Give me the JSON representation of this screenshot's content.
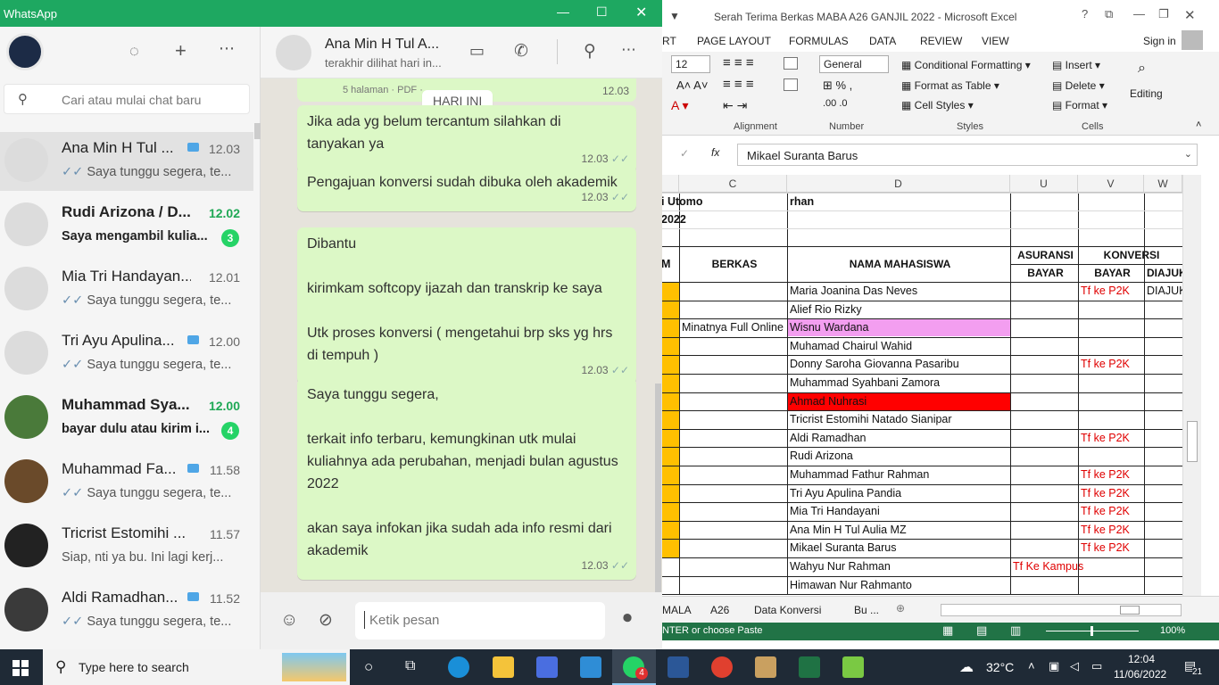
{
  "excel": {
    "title": "Serah Terima Berkas MABA A26 GANJIL 2022 - Microsoft Excel",
    "sign_in": "Sign in",
    "tabs": [
      "RT",
      "PAGE LAYOUT",
      "FORMULAS",
      "DATA",
      "REVIEW",
      "VIEW"
    ],
    "ribbon": {
      "font_size": "12",
      "number_format": "General",
      "alignment_label": "Alignment",
      "number_label": "Number",
      "styles_label": "Styles",
      "cells_label": "Cells",
      "conditional_formatting": "Conditional Formatting",
      "format_as_table": "Format as Table",
      "cell_styles": "Cell Styles",
      "insert": "Insert",
      "delete": "Delete",
      "format": "Format",
      "editing": "Editing"
    },
    "formula_bar": {
      "fx": "fx",
      "value": "Mikael Suranta Barus"
    },
    "columns": [
      "C",
      "D",
      "U",
      "V",
      "W"
    ],
    "top_rows": {
      "b1": "i Utomo",
      "d1": "rhan",
      "b2": "2022"
    },
    "headers": {
      "m": "M",
      "berkas": "BERKAS",
      "nama": "NAMA MAHASISWA",
      "asuransi": "ASURANSI",
      "konversi": "KONVERSI",
      "bayar1": "BAYAR",
      "bayar2": "BAYAR",
      "diajuk": "DIAJUK"
    },
    "rows": [
      {
        "c": "",
        "d": "Maria Joanina Das Neves",
        "u": "",
        "v": "Tf ke P2K",
        "w": "DIAJUK",
        "yellow": true,
        "fill": ""
      },
      {
        "c": "",
        "d": "Alief Rio Rizky",
        "u": "",
        "v": "",
        "w": "",
        "yellow": true,
        "fill": ""
      },
      {
        "c": "Minatnya Full Online",
        "d": "Wisnu Wardana",
        "u": "",
        "v": "",
        "w": "",
        "yellow": true,
        "fill": "#f39ef0"
      },
      {
        "c": "",
        "d": "Muhamad Chairul Wahid",
        "u": "",
        "v": "",
        "w": "",
        "yellow": true,
        "fill": ""
      },
      {
        "c": "",
        "d": "Donny Saroha Giovanna Pasaribu",
        "u": "",
        "v": "Tf ke P2K",
        "w": "",
        "yellow": true,
        "fill": ""
      },
      {
        "c": "",
        "d": "Muhammad Syahbani Zamora",
        "u": "",
        "v": "",
        "w": "",
        "yellow": true,
        "fill": ""
      },
      {
        "c": "",
        "d": "Ahmad Nuhrasi",
        "u": "",
        "v": "",
        "w": "",
        "yellow": true,
        "fill": "#ff0000"
      },
      {
        "c": "",
        "d": "Tricrist Estomihi Natado Sianipar",
        "u": "",
        "v": "",
        "w": "",
        "yellow": true,
        "fill": ""
      },
      {
        "c": "",
        "d": "Aldi Ramadhan",
        "u": "",
        "v": "Tf ke P2K",
        "w": "",
        "yellow": true,
        "fill": ""
      },
      {
        "c": "",
        "d": "Rudi Arizona",
        "u": "",
        "v": "",
        "w": "",
        "yellow": true,
        "fill": ""
      },
      {
        "c": "",
        "d": "Muhammad Fathur Rahman",
        "u": "",
        "v": "Tf ke P2K",
        "w": "",
        "yellow": true,
        "fill": ""
      },
      {
        "c": "",
        "d": "Tri Ayu Apulina Pandia",
        "u": "",
        "v": "Tf ke P2K",
        "w": "",
        "yellow": true,
        "fill": ""
      },
      {
        "c": "",
        "d": "Mia Tri Handayani",
        "u": "",
        "v": "Tf ke P2K",
        "w": "",
        "yellow": true,
        "fill": ""
      },
      {
        "c": "",
        "d": "Ana Min H Tul Aulia MZ",
        "u": "",
        "v": "Tf ke P2K",
        "w": "",
        "yellow": true,
        "fill": ""
      },
      {
        "c": "",
        "d": "Mikael Suranta Barus",
        "u": "",
        "v": "Tf ke P2K",
        "w": "",
        "yellow": true,
        "fill": ""
      },
      {
        "c": "",
        "d": "Wahyu Nur Rahman",
        "u": "Tf Ke Kampus",
        "v": "",
        "w": "",
        "yellow": false,
        "fill": ""
      },
      {
        "c": "",
        "d": "Himawan Nur Rahmanto",
        "u": "",
        "v": "",
        "w": "",
        "yellow": false,
        "fill": ""
      }
    ],
    "sheets": [
      "MALA",
      "A26",
      "Data Konversi",
      "Bu ..."
    ],
    "status": "NTER or choose Paste",
    "zoom": "100%"
  },
  "whatsapp": {
    "app_title": "WhatsApp",
    "search_placeholder": "Cari atau mulai chat baru",
    "chats": [
      {
        "name": "Ana Min H Tul ...",
        "time": "12.03",
        "preview": "Saya tunggu segera,   te...",
        "badge": "",
        "ticks": true,
        "pin": true,
        "bold": false,
        "selected": true
      },
      {
        "name": "Rudi Arizona / D...",
        "time": "12.02",
        "preview": "Saya mengambil kulia...",
        "badge": "3",
        "ticks": false,
        "pin": false,
        "bold": true,
        "selected": false
      },
      {
        "name": "Mia Tri Handayan...",
        "time": "12.01",
        "preview": "Saya tunggu segera,   te...",
        "badge": "",
        "ticks": true,
        "pin": false,
        "bold": false,
        "selected": false
      },
      {
        "name": "Tri Ayu Apulina...",
        "time": "12.00",
        "preview": "Saya tunggu segera,   te...",
        "badge": "",
        "ticks": true,
        "pin": true,
        "bold": false,
        "selected": false
      },
      {
        "name": "Muhammad Sya...",
        "time": "12.00",
        "preview": "bayar dulu atau kirim i...",
        "badge": "4",
        "ticks": false,
        "pin": false,
        "bold": true,
        "selected": false
      },
      {
        "name": "Muhammad Fa...",
        "time": "11.58",
        "preview": "Saya tunggu segera,   te...",
        "badge": "",
        "ticks": true,
        "pin": true,
        "bold": false,
        "selected": false
      },
      {
        "name": "Tricrist Estomihi ...",
        "time": "11.57",
        "preview": "Siap, nti ya bu. Ini lagi kerj...",
        "badge": "",
        "ticks": false,
        "pin": false,
        "bold": false,
        "selected": false
      },
      {
        "name": "Aldi Ramadhan...",
        "time": "11.52",
        "preview": "Saya tunggu segera,   te...",
        "badge": "",
        "ticks": true,
        "pin": true,
        "bold": false,
        "selected": false
      }
    ],
    "contact_name": "Ana Min H Tul A...",
    "contact_status": "terakhir dilihat hari in...",
    "date_chip": "HARI INI",
    "doc_meta": "5 halaman · PDF ·",
    "doc_time": "12.03",
    "messages": [
      {
        "lines": [
          "Jika ada yg belum tercantum silahkan di",
          "tanyakan ya"
        ],
        "time": "12.03"
      },
      {
        "lines": [
          "Pengajuan konversi sudah dibuka oleh akademik"
        ],
        "time": "12.03"
      },
      {
        "lines": [
          "Dibantu",
          "",
          "kirimkam softcopy ijazah dan transkrip ke saya",
          "",
          "Utk proses konversi ( mengetahui brp sks yg hrs",
          "di tempuh )"
        ],
        "time": "12.03"
      },
      {
        "lines": [
          "Saya tunggu segera,",
          "",
          "terkait info terbaru, kemungkinan utk mulai",
          "kuliahnya ada perubahan, menjadi bulan agustus",
          "2022",
          "",
          "akan saya infokan jika sudah ada info resmi dari",
          "akademik"
        ],
        "time": "12.03"
      }
    ],
    "compose_placeholder": "Ketik pesan"
  },
  "taskbar": {
    "search_text": "Type here to search",
    "wa_badge": "4",
    "temperature": "32°C",
    "time": "12:04",
    "date": "11/06/2022",
    "notif_count": "21"
  }
}
